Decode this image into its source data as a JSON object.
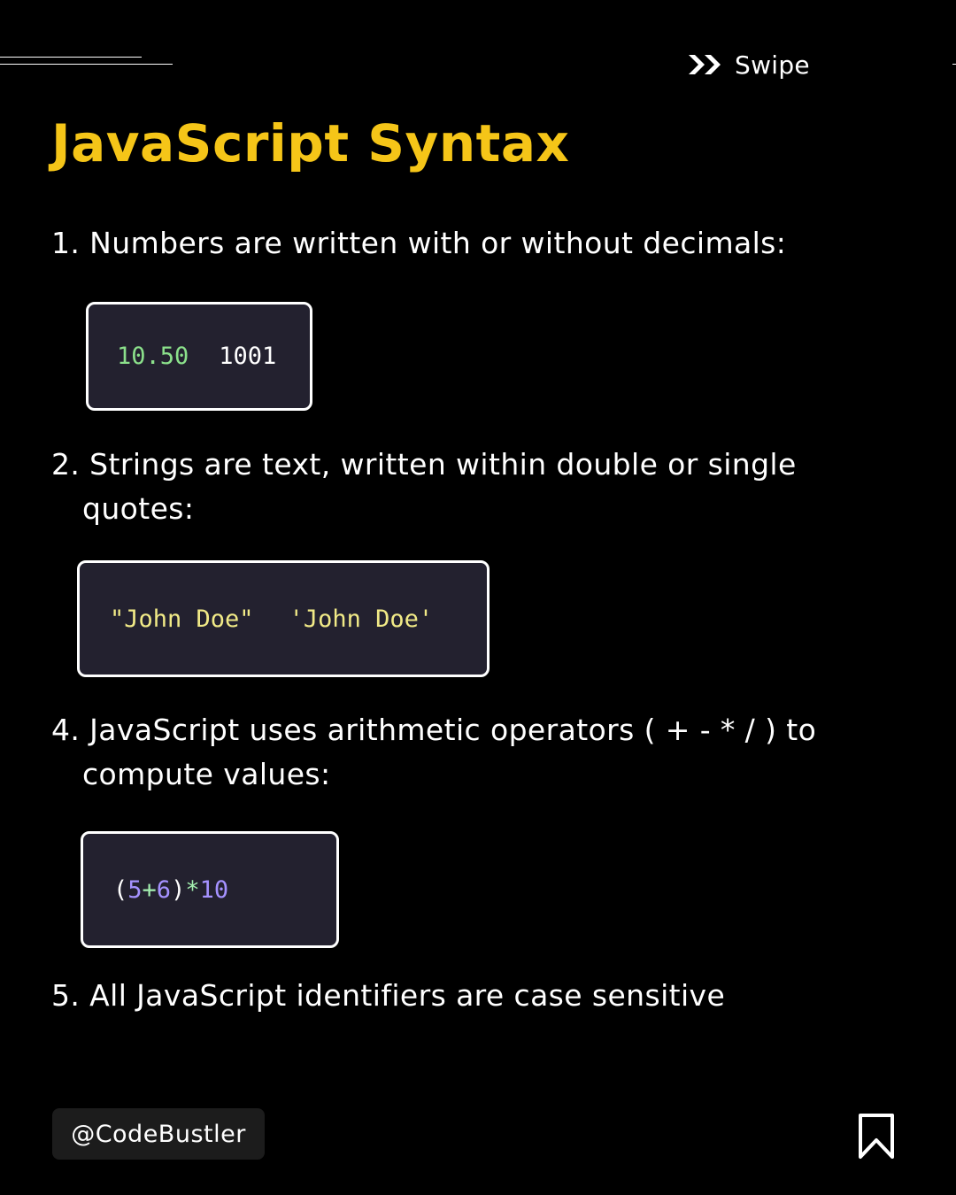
{
  "swipe": {
    "label": "Swipe",
    "icon": "double-chevron-right-icon"
  },
  "title": "JavaScript Syntax",
  "points": [
    {
      "line1": "1. Numbers are written with or without decimals:",
      "line2": ""
    },
    {
      "line1": "2. Strings are text, written within double or single",
      "line2": "quotes:"
    },
    {
      "line1": "4. JavaScript uses arithmetic operators ( + - * / ) to",
      "line2": "compute values:"
    },
    {
      "line1": "5. All JavaScript identifiers are case sensitive",
      "line2": ""
    }
  ],
  "code": {
    "numbers": {
      "decimal": "10.50",
      "integer": "1001"
    },
    "strings": {
      "double": "\"John Doe\"",
      "single": "'John Doe'"
    },
    "arithmetic": {
      "open_paren": "(",
      "a": "5",
      "plus": "+",
      "b": "6",
      "close_paren": ")",
      "times": "*",
      "c": "10"
    }
  },
  "footer": {
    "handle": "@CodeBustler",
    "bookmark_icon": "bookmark-icon"
  },
  "colors": {
    "background": "#000000",
    "title": "#f5c518",
    "code_bg": "#23212f",
    "code_number": "#8be08b",
    "code_string": "#f1ea87",
    "code_operand": "#a592ff"
  }
}
